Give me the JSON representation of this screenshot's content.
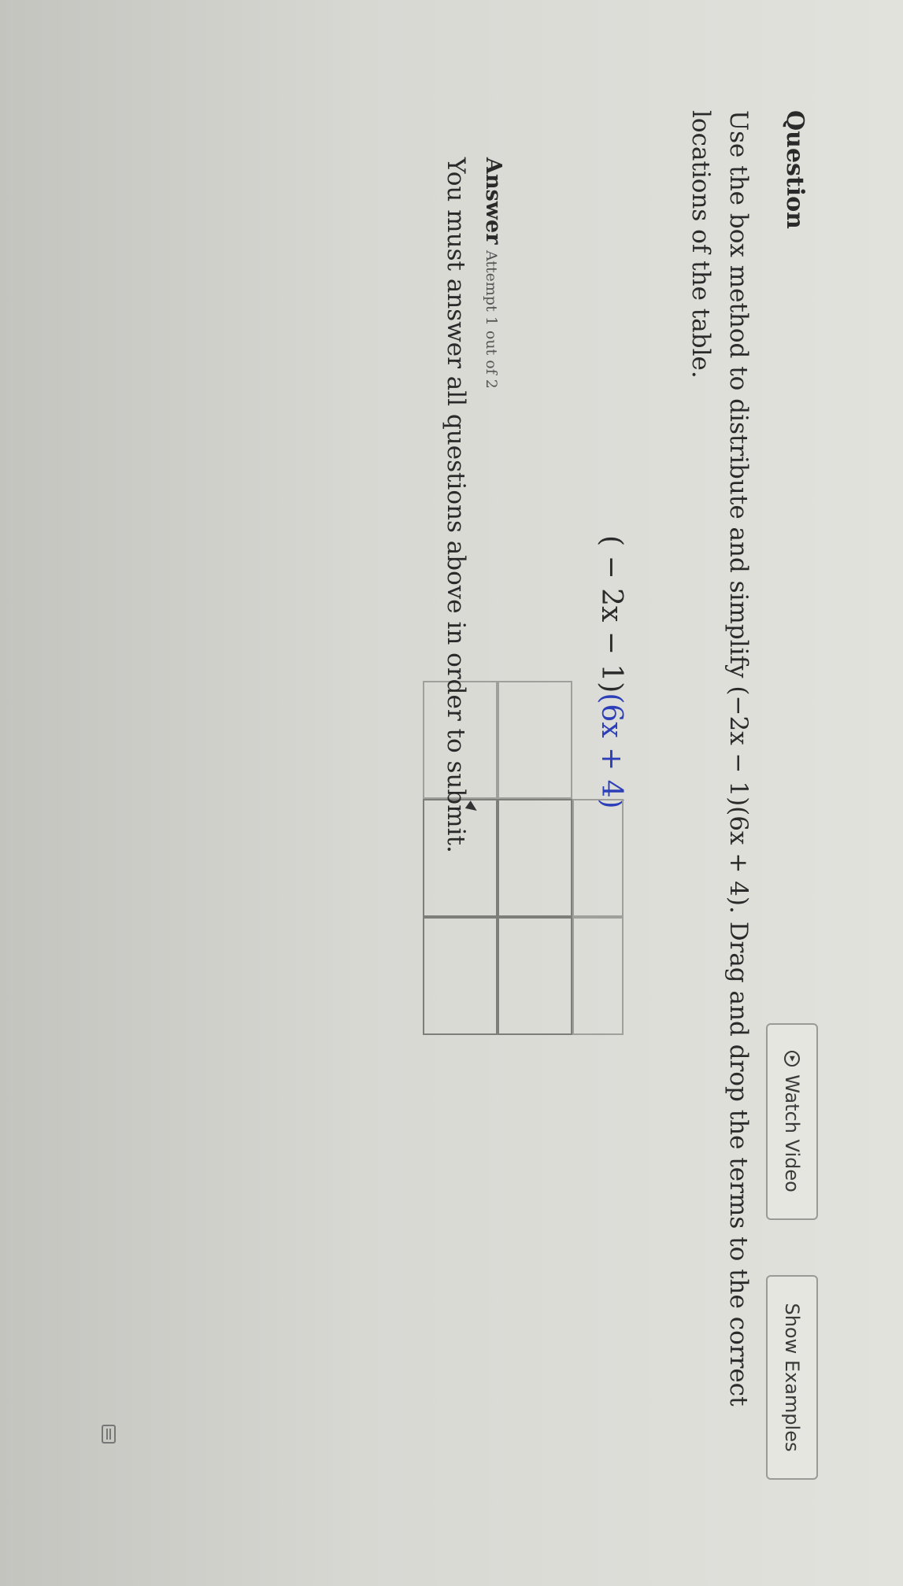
{
  "question": {
    "heading": "Question",
    "watch_video_label": "Watch Video",
    "show_examples_label": "Show Examples",
    "prompt_before": "Use the box method to distribute and simplify ",
    "prompt_expr": "(−2x − 1)(6x + 4)",
    "prompt_after": ". Drag and drop the terms to the correct locations of the table.",
    "expression_left": "( − 2x − 1)",
    "expression_right": "(6x + 4)"
  },
  "answer": {
    "heading": "Answer",
    "attempt": "Attempt 1 out of 2",
    "submit_message": "You must answer all questions above in order to submit."
  },
  "icons": {
    "play": "play-circle-icon",
    "keyboard": "keyboard-icon"
  }
}
